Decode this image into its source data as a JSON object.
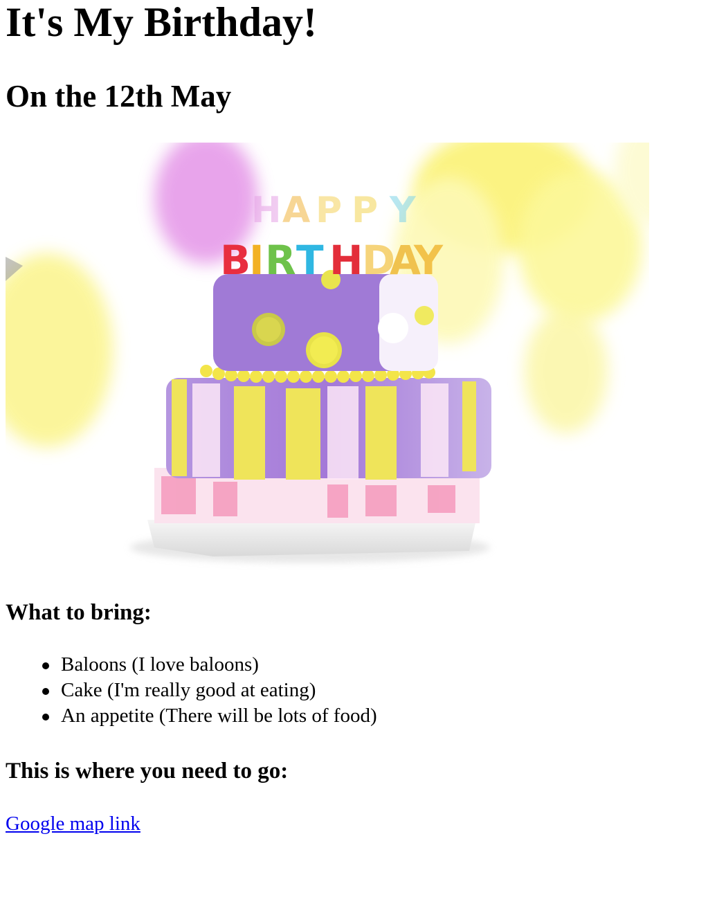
{
  "header": {
    "title": "It's My Birthday!",
    "date": "On the 12th May"
  },
  "hero_image": {
    "candle_letters_top": [
      "H",
      "A",
      "P",
      "P",
      "Y"
    ],
    "candle_letters_bottom": [
      "B",
      "I",
      "R",
      "T",
      "H",
      "D",
      "A",
      "Y"
    ]
  },
  "bring": {
    "title": "What to bring:",
    "items": [
      "Baloons (I love baloons)",
      "Cake (I'm really good at eating)",
      "An appetite (There will be lots of food)"
    ]
  },
  "directions": {
    "title": "This is where you need to go:",
    "link_label": "Google map link"
  },
  "colors": {
    "link": "#0000ee",
    "cake_purple": "#a777d6",
    "cake_yellow": "#f1e63c",
    "balloon_pink": "#e79aea",
    "balloon_yellow": "#fbf58c"
  }
}
